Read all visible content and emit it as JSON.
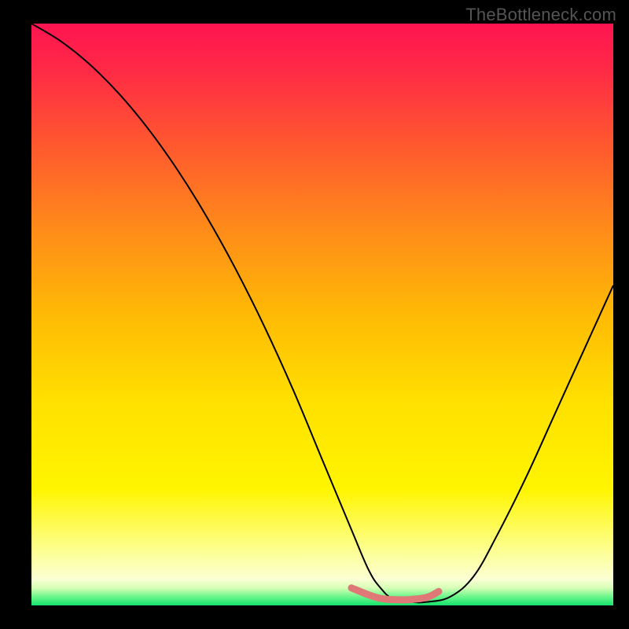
{
  "watermark": "TheBottleneck.com",
  "chart_data": {
    "type": "line",
    "title": "",
    "xlabel": "",
    "ylabel": "",
    "xlim": [
      0,
      100
    ],
    "ylim": [
      0,
      100
    ],
    "grid": false,
    "background_gradient": {
      "stops": [
        {
          "pos": 0.0,
          "color": "#ff1450"
        },
        {
          "pos": 0.08,
          "color": "#ff2a46"
        },
        {
          "pos": 0.2,
          "color": "#ff5530"
        },
        {
          "pos": 0.35,
          "color": "#ff8a1a"
        },
        {
          "pos": 0.5,
          "color": "#ffba05"
        },
        {
          "pos": 0.65,
          "color": "#ffe000"
        },
        {
          "pos": 0.8,
          "color": "#fff500"
        },
        {
          "pos": 0.9,
          "color": "#fdff8a"
        },
        {
          "pos": 0.955,
          "color": "#fbffd4"
        },
        {
          "pos": 0.97,
          "color": "#d6ffb6"
        },
        {
          "pos": 0.985,
          "color": "#6cf58a"
        },
        {
          "pos": 1.0,
          "color": "#14e56e"
        }
      ]
    },
    "series": [
      {
        "name": "bottleneck-curve",
        "color": "#000000",
        "width": 2,
        "x": [
          0,
          5,
          10,
          15,
          20,
          25,
          30,
          35,
          40,
          45,
          50,
          55,
          58,
          60,
          62,
          65,
          68,
          72,
          76,
          80,
          85,
          90,
          95,
          100
        ],
        "y": [
          100,
          97,
          93,
          88,
          82,
          75,
          67,
          58,
          48,
          37,
          25,
          13,
          6,
          3,
          1.2,
          0.6,
          0.6,
          1.5,
          5,
          12,
          22,
          33,
          44,
          55
        ]
      },
      {
        "name": "optimal-zone",
        "color": "#e07878",
        "width": 9,
        "x": [
          55,
          58,
          60,
          62,
          65,
          68,
          70
        ],
        "y": [
          3.0,
          1.8,
          1.2,
          1.0,
          1.0,
          1.4,
          2.4
        ]
      }
    ]
  }
}
